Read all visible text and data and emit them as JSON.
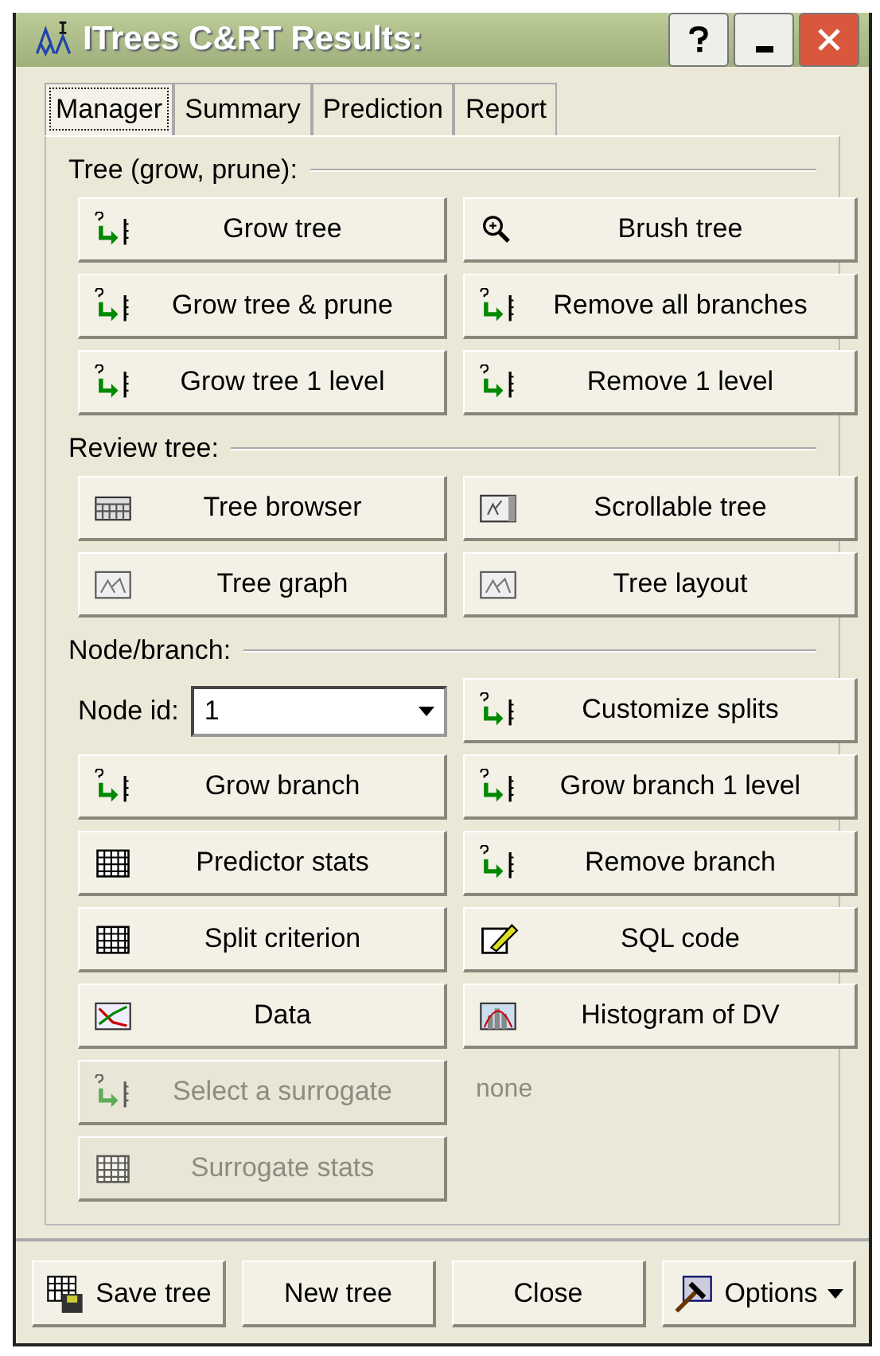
{
  "window": {
    "title": "ITrees C&RT Results:"
  },
  "tabs": [
    {
      "label": "Manager",
      "selected": true
    },
    {
      "label": "Summary",
      "selected": false
    },
    {
      "label": "Prediction",
      "selected": false
    },
    {
      "label": "Report",
      "selected": false
    }
  ],
  "sections": [
    {
      "title": "Tree (grow, prune):",
      "items": [
        {
          "kind": "button",
          "label": "Grow tree",
          "disabled": false
        },
        {
          "kind": "button",
          "label": "Brush tree",
          "disabled": false
        },
        {
          "kind": "button",
          "label": "Grow tree & prune",
          "disabled": false
        },
        {
          "kind": "button",
          "label": "Remove all branches",
          "disabled": false
        },
        {
          "kind": "button",
          "label": "Grow tree 1 level",
          "disabled": false
        },
        {
          "kind": "button",
          "label": "Remove 1 level",
          "disabled": false
        }
      ]
    },
    {
      "title": "Review tree:",
      "items": [
        {
          "kind": "button",
          "label": "Tree browser",
          "disabled": false
        },
        {
          "kind": "button",
          "label": "Scrollable tree",
          "disabled": false
        },
        {
          "kind": "button",
          "label": "Tree graph",
          "disabled": false
        },
        {
          "kind": "button",
          "label": "Tree layout",
          "disabled": false
        }
      ]
    },
    {
      "title": "Node/branch:",
      "items": [
        {
          "kind": "combo",
          "label": "Node id:",
          "value": "1"
        },
        {
          "kind": "button",
          "label": "Customize splits",
          "disabled": false
        },
        {
          "kind": "button",
          "label": "Grow branch",
          "disabled": false
        },
        {
          "kind": "button",
          "label": "Grow branch 1 level",
          "disabled": false
        },
        {
          "kind": "button",
          "label": "Predictor stats",
          "disabled": false
        },
        {
          "kind": "button",
          "label": "Remove branch",
          "disabled": false
        },
        {
          "kind": "button",
          "label": "Split criterion",
          "disabled": false
        },
        {
          "kind": "button",
          "label": "SQL code",
          "disabled": false
        },
        {
          "kind": "button",
          "label": "Data",
          "disabled": false
        },
        {
          "kind": "button",
          "label": "Histogram of DV",
          "disabled": false
        },
        {
          "kind": "button",
          "label": "Select a surrogate",
          "disabled": true
        },
        {
          "kind": "note",
          "label": "none",
          "disabled": true
        },
        {
          "kind": "button",
          "label": "Surrogate stats",
          "disabled": true
        }
      ]
    }
  ],
  "footer": [
    {
      "label": "Save tree",
      "dropdown": false
    },
    {
      "label": "New tree",
      "dropdown": false
    },
    {
      "label": "Close",
      "dropdown": false
    },
    {
      "label": "Options",
      "dropdown": true
    }
  ]
}
